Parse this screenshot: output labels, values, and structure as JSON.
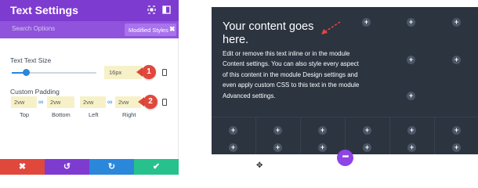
{
  "panel": {
    "title": "Text Settings",
    "search_placeholder": "Search Options",
    "filter_label": "Modified Styles",
    "filter_close": "✖",
    "text_size": {
      "label": "Text Text Size",
      "value": "16px",
      "slider_fraction": 0.17
    },
    "padding": {
      "label": "Custom Padding",
      "top": "2vw",
      "bottom": "2vw",
      "left": "2vw",
      "right": "2vw",
      "captions": [
        "Top",
        "Bottom",
        "Left",
        "Right"
      ]
    },
    "badges": [
      "1",
      "2"
    ],
    "footer": {
      "cancel": "✖",
      "undo": "↺",
      "redo": "↻",
      "save": "✔"
    }
  },
  "canvas": {
    "heading": "Your content goes here.",
    "body": "Edit or remove this text inline or in the module Content settings. You can also style every aspect of this content in the module Design settings and even apply custom CSS to this text in the module Advanced settings.",
    "add_symbol": "+",
    "menu_symbol": "•••"
  },
  "colors": {
    "header": "#7e3bd0",
    "accent_blue": "#2b87da",
    "modified_field": "#f6f1c8",
    "badge": "#e0483c",
    "canvas_bg": "#2c3440",
    "cancel": "#e0483c",
    "undo": "#7e3bd0",
    "redo": "#2b87da",
    "save": "#27c18d"
  },
  "icons": [
    "expand-icon",
    "sidebar-icon",
    "link-icon",
    "mobile-device-icon",
    "move-cursor-icon",
    "dashed-arrow-icon"
  ]
}
